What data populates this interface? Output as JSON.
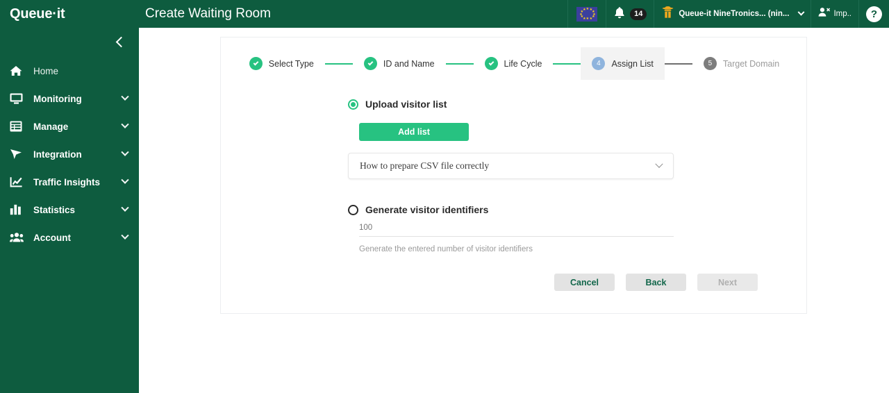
{
  "brand": {
    "name": "Queue·it"
  },
  "sidebar": {
    "collapse_icon": "chevron-left-icon",
    "items": [
      {
        "label": "Home",
        "icon": "home-icon",
        "expandable": false
      },
      {
        "label": "Monitoring",
        "icon": "monitor-icon",
        "expandable": true
      },
      {
        "label": "Manage",
        "icon": "list-icon",
        "expandable": true
      },
      {
        "label": "Integration",
        "icon": "share-icon",
        "expandable": true
      },
      {
        "label": "Traffic Insights",
        "icon": "line-chart-icon",
        "expandable": true
      },
      {
        "label": "Statistics",
        "icon": "bar-chart-icon",
        "expandable": true
      },
      {
        "label": "Account",
        "icon": "users-icon",
        "expandable": true
      }
    ]
  },
  "topbar": {
    "title": "Create Waiting Room",
    "flag_icon": "eu-flag-icon",
    "bell_icon": "bell-icon",
    "notification_count": "14",
    "account_icon": "detective-icon",
    "account_name": "Queue-it NineTronics... (nin...",
    "impersonate_icon": "user-remove-icon",
    "impersonate_label": "Imp..",
    "help_label": "?"
  },
  "stepper": {
    "steps": [
      {
        "label": "Select Type",
        "state": "done",
        "badge": "✓"
      },
      {
        "label": "ID and Name",
        "state": "done",
        "badge": "✓"
      },
      {
        "label": "Life Cycle",
        "state": "done",
        "badge": "✓"
      },
      {
        "label": "Assign List",
        "state": "current",
        "badge": "4"
      },
      {
        "label": "Target Domain",
        "state": "todo",
        "badge": "5"
      }
    ]
  },
  "form": {
    "upload_option_label": "Upload visitor list",
    "upload_option_selected": true,
    "add_list_label": "Add list",
    "accordion_label": "How to prepare CSV file correctly",
    "accordion_icon": "chevron-down-icon",
    "generate_option_label": "Generate visitor identifiers",
    "generate_option_selected": false,
    "generate_count_placeholder": "100",
    "generate_count_value": "",
    "generate_hint": "Generate the entered number of visitor identifiers"
  },
  "actions": {
    "cancel_label": "Cancel",
    "back_label": "Back",
    "next_label": "Next",
    "next_disabled": true
  },
  "colors": {
    "brand_green_dark": "#0E5C3F",
    "accent_green": "#27C281",
    "step_current_blue": "#8FB4DD",
    "step_todo_grey": "#7D7D7D",
    "button_grey": "#E3E3E3",
    "button_text_green": "#12664A"
  }
}
